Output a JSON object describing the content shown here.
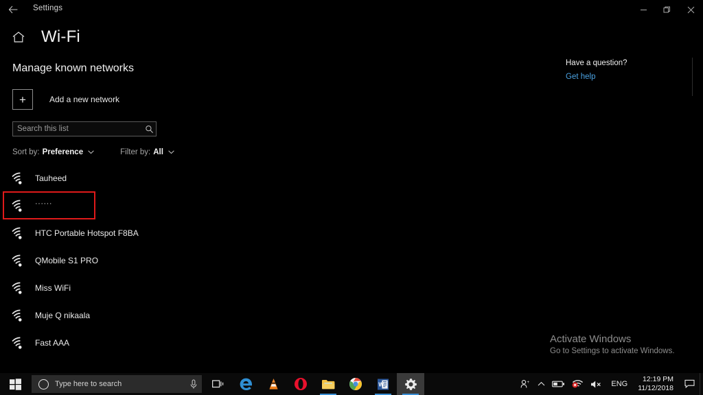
{
  "window": {
    "back_icon": "back-arrow-icon",
    "title": "Settings",
    "minimize_label": "—",
    "restore_label": "❐",
    "close_label": "✕"
  },
  "page": {
    "home_icon": "home-icon",
    "title": "Wi-Fi",
    "section_title": "Manage known networks"
  },
  "add_network": {
    "plus_label": "+",
    "label": "Add a new network"
  },
  "search": {
    "placeholder": "Search this list",
    "value": "",
    "icon": "search-icon"
  },
  "controls": {
    "sort": {
      "label": "Sort by:",
      "value": "Preference",
      "chevron": "∨"
    },
    "filter": {
      "label": "Filter by:",
      "value": "All",
      "chevron": "∨"
    }
  },
  "networks": [
    {
      "name": "Tauheed",
      "selected": false,
      "hidden_ssid": false
    },
    {
      "name": "······",
      "selected": true,
      "hidden_ssid": true
    },
    {
      "name": "HTC Portable Hotspot F8BA",
      "selected": false,
      "hidden_ssid": false
    },
    {
      "name": "QMobile S1 PRO",
      "selected": false,
      "hidden_ssid": false
    },
    {
      "name": "Miss WiFi",
      "selected": false,
      "hidden_ssid": false
    },
    {
      "name": "Muje Q nikaala",
      "selected": false,
      "hidden_ssid": false
    },
    {
      "name": "Fast AAA",
      "selected": false,
      "hidden_ssid": false
    }
  ],
  "help": {
    "heading": "Have a question?",
    "link": "Get help"
  },
  "watermark": {
    "title": "Activate Windows",
    "subtitle": "Go to Settings to activate Windows."
  },
  "taskbar": {
    "start_icon": "windows-start-icon",
    "search_placeholder": "Type here to search",
    "mic_icon": "microphone-icon",
    "apps": [
      {
        "name": "task-view-icon",
        "active": false,
        "running": false
      },
      {
        "name": "microsoft-edge-icon",
        "active": false,
        "running": false
      },
      {
        "name": "vlc-media-player-icon",
        "active": false,
        "running": false
      },
      {
        "name": "opera-browser-icon",
        "active": false,
        "running": false
      },
      {
        "name": "file-explorer-icon",
        "active": false,
        "running": true
      },
      {
        "name": "google-chrome-icon",
        "active": false,
        "running": false
      },
      {
        "name": "microsoft-word-icon",
        "active": false,
        "running": true
      },
      {
        "name": "settings-gear-icon",
        "active": true,
        "running": true
      }
    ],
    "tray": {
      "people_icon": "people-icon",
      "chevron_icon": "show-hidden-icons-chevron",
      "battery_icon": "battery-icon",
      "wifi_icon": "wifi-disconnected-icon",
      "volume_icon": "volume-muted-icon",
      "language": "ENG",
      "time": "12:19 PM",
      "date": "11/12/2018",
      "action_center_icon": "action-center-icon"
    }
  },
  "colors": {
    "accent_link": "#4ba3e3",
    "highlight_box": "#e01a1a",
    "taskbar_bg": "#0a0a0a",
    "window_bg": "#000000"
  }
}
